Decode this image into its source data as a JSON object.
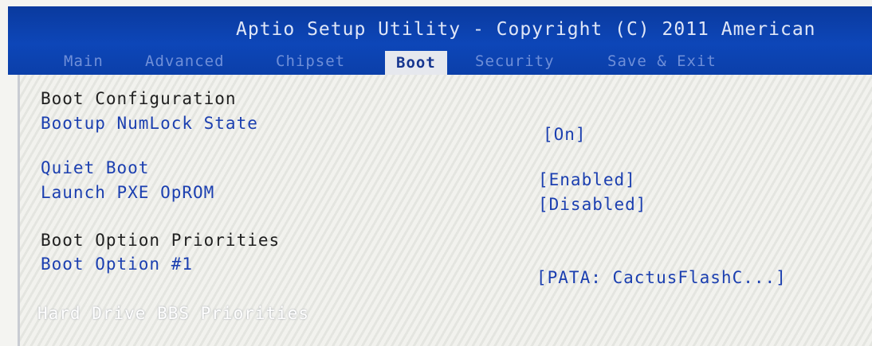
{
  "window": {
    "title": "Aptio Setup Utility - Copyright (C) 2011 American"
  },
  "tabs": [
    {
      "label": "Main",
      "active": false
    },
    {
      "label": "Advanced",
      "active": false
    },
    {
      "label": "Chipset",
      "active": false
    },
    {
      "label": "Boot",
      "active": true
    },
    {
      "label": "Security",
      "active": false
    },
    {
      "label": "Save & Exit",
      "active": false
    }
  ],
  "boot": {
    "boot_configuration_heading": "Boot Configuration",
    "settings": [
      {
        "label": "Bootup NumLock State",
        "value": "[On]"
      },
      {
        "label": "Quiet Boot",
        "value": "[Enabled]"
      },
      {
        "label": "Launch PXE OpROM",
        "value": "[Disabled]"
      }
    ],
    "boot_option_priorities_heading": "Boot Option Priorities",
    "boot_options": [
      {
        "label": "Boot Option #1",
        "value": "[PATA: CactusFlashC...]"
      }
    ],
    "submenus": [
      {
        "label": "Hard Drive BBS Priorities"
      }
    ]
  },
  "colors": {
    "header_bg": "#0b3fa9",
    "active_tab_bg": "#e6e8ee",
    "item_text": "#1b3fb0",
    "heading_text": "#202020"
  }
}
